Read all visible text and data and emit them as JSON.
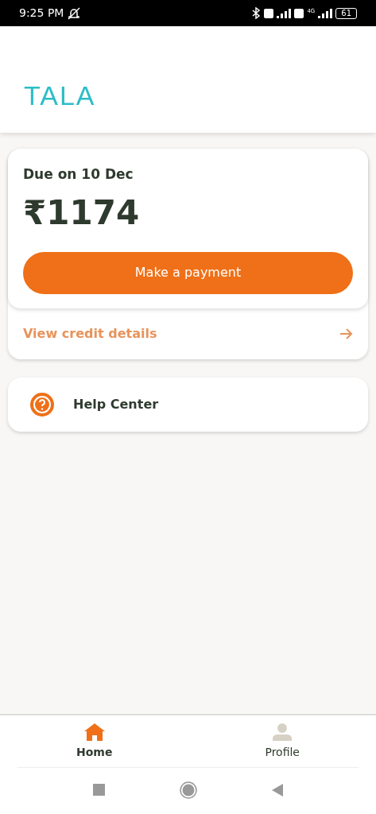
{
  "status_bar": {
    "time": "9:25 PM",
    "network": "4G",
    "battery": "61"
  },
  "header": {
    "logo": "TALA"
  },
  "due_card": {
    "due_label": "Due on 10 Dec",
    "amount": "₹1174",
    "pay_button": "Make a payment",
    "details_link": "View credit details"
  },
  "help": {
    "label": "Help Center"
  },
  "bottom_nav": [
    {
      "label": "Home",
      "kind": "home",
      "selected": true
    },
    {
      "label": "Profile",
      "kind": "profile",
      "selected": false
    }
  ]
}
